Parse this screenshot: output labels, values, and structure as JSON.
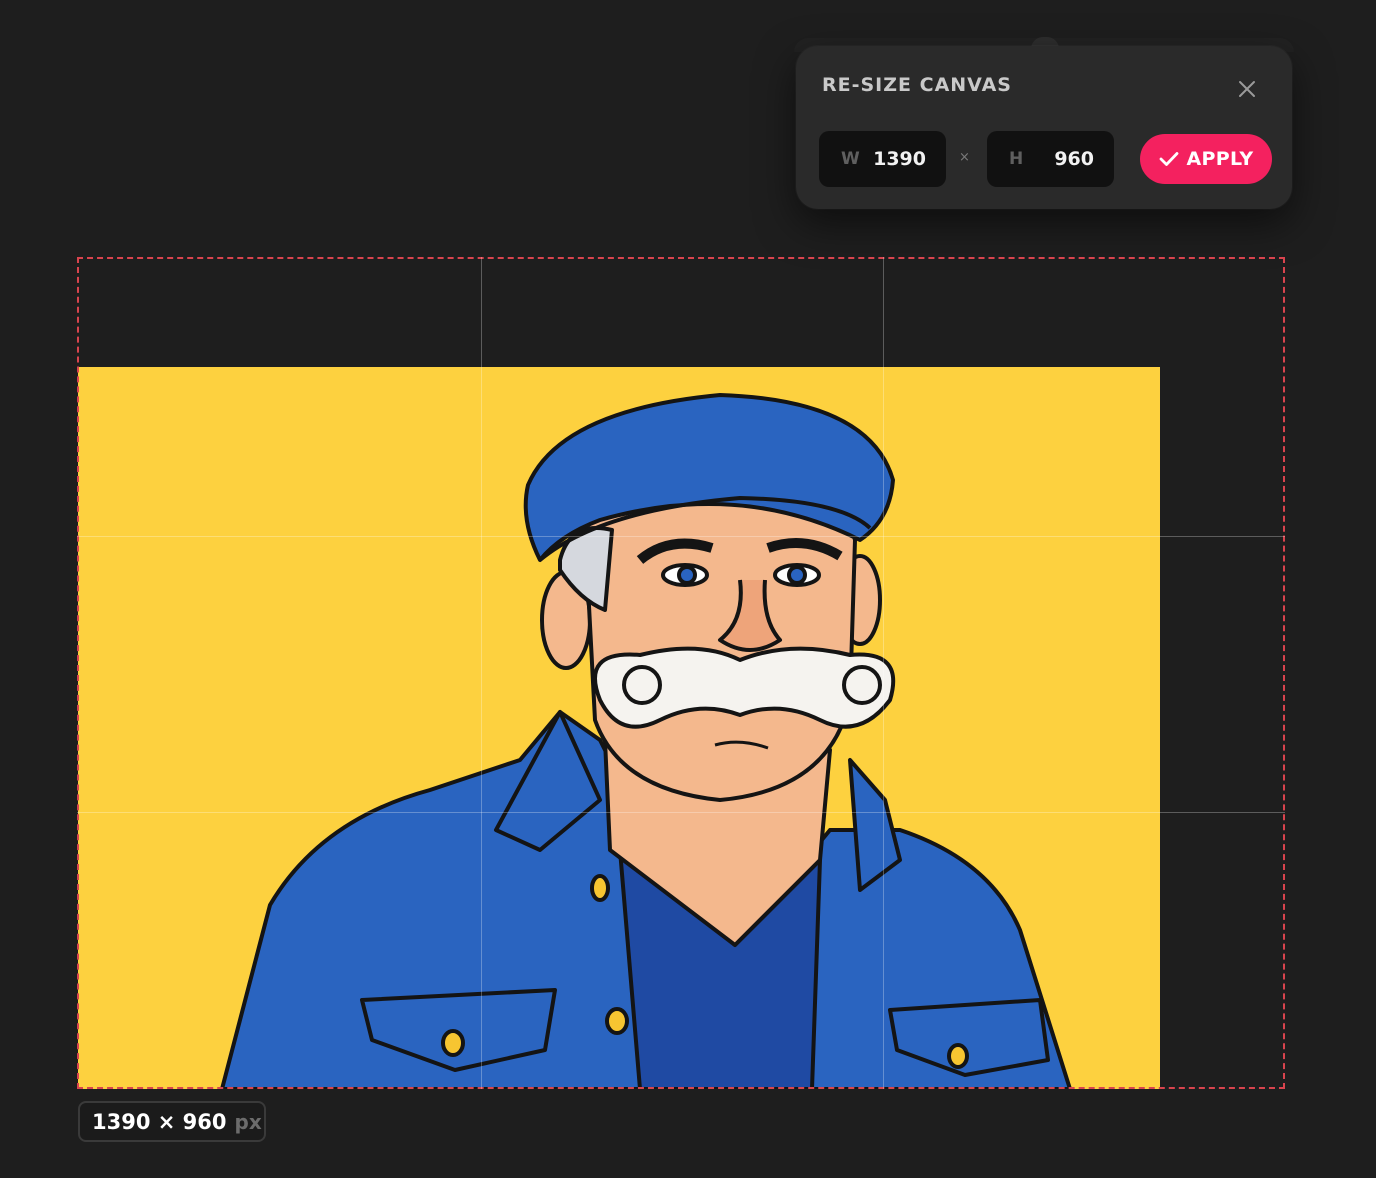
{
  "popover": {
    "title": "RE-SIZE CANVAS",
    "close_icon": "close-icon",
    "width_label": "W",
    "width_value": "1390",
    "separator": "×",
    "height_label": "H",
    "height_value": "960",
    "apply_label": "APPLY",
    "apply_icon": "check-icon",
    "apply_color": "#f4215f"
  },
  "canvas": {
    "frame_color": "#d8444e",
    "image_background": "#fdd13f",
    "image_subject": "cartoon-man-with-mustache"
  },
  "size_badge": {
    "dims": "1390 × 960",
    "unit": "px"
  }
}
